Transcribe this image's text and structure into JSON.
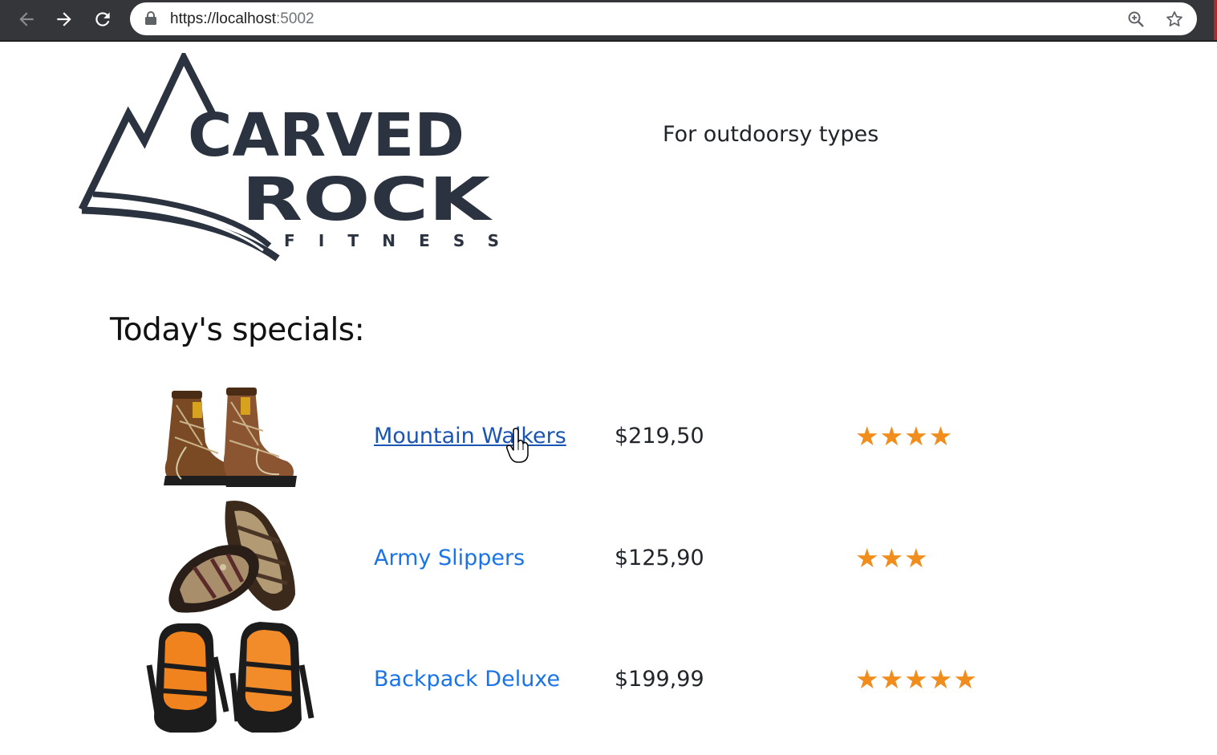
{
  "browser": {
    "url_base": "https://localhost",
    "url_port": ":5002",
    "icons": {
      "back": "arrow-left-icon",
      "forward": "arrow-right-icon",
      "reload": "reload-icon",
      "lock": "lock-icon",
      "zoom": "zoom-in-icon",
      "bookmark": "star-outline-icon"
    }
  },
  "header": {
    "logo_alt": "Carved Rock Fitness",
    "logo_text": [
      "CARVED",
      "ROCK",
      "FITNESS"
    ],
    "tagline": "For outdoorsy types"
  },
  "specials": {
    "title": "Today's specials:",
    "products": [
      {
        "name": "Mountain Walkers",
        "price": "$219,50",
        "rating": 4,
        "stars": "★★★★",
        "image": "hiking-boots-image",
        "hovered": true
      },
      {
        "name": "Army Slippers",
        "price": "$125,90",
        "rating": 3,
        "stars": "★★★",
        "image": "sandals-image",
        "hovered": false
      },
      {
        "name": "Backpack Deluxe",
        "price": "$199,99",
        "rating": 5,
        "stars": "★★★★★",
        "image": "backpacks-image",
        "hovered": false
      }
    ]
  },
  "colors": {
    "chrome_bg": "#35363a",
    "link": "#1a73e8",
    "link_hover": "#1a55b3",
    "star": "#f08d1c",
    "logo": "#2b3340"
  }
}
